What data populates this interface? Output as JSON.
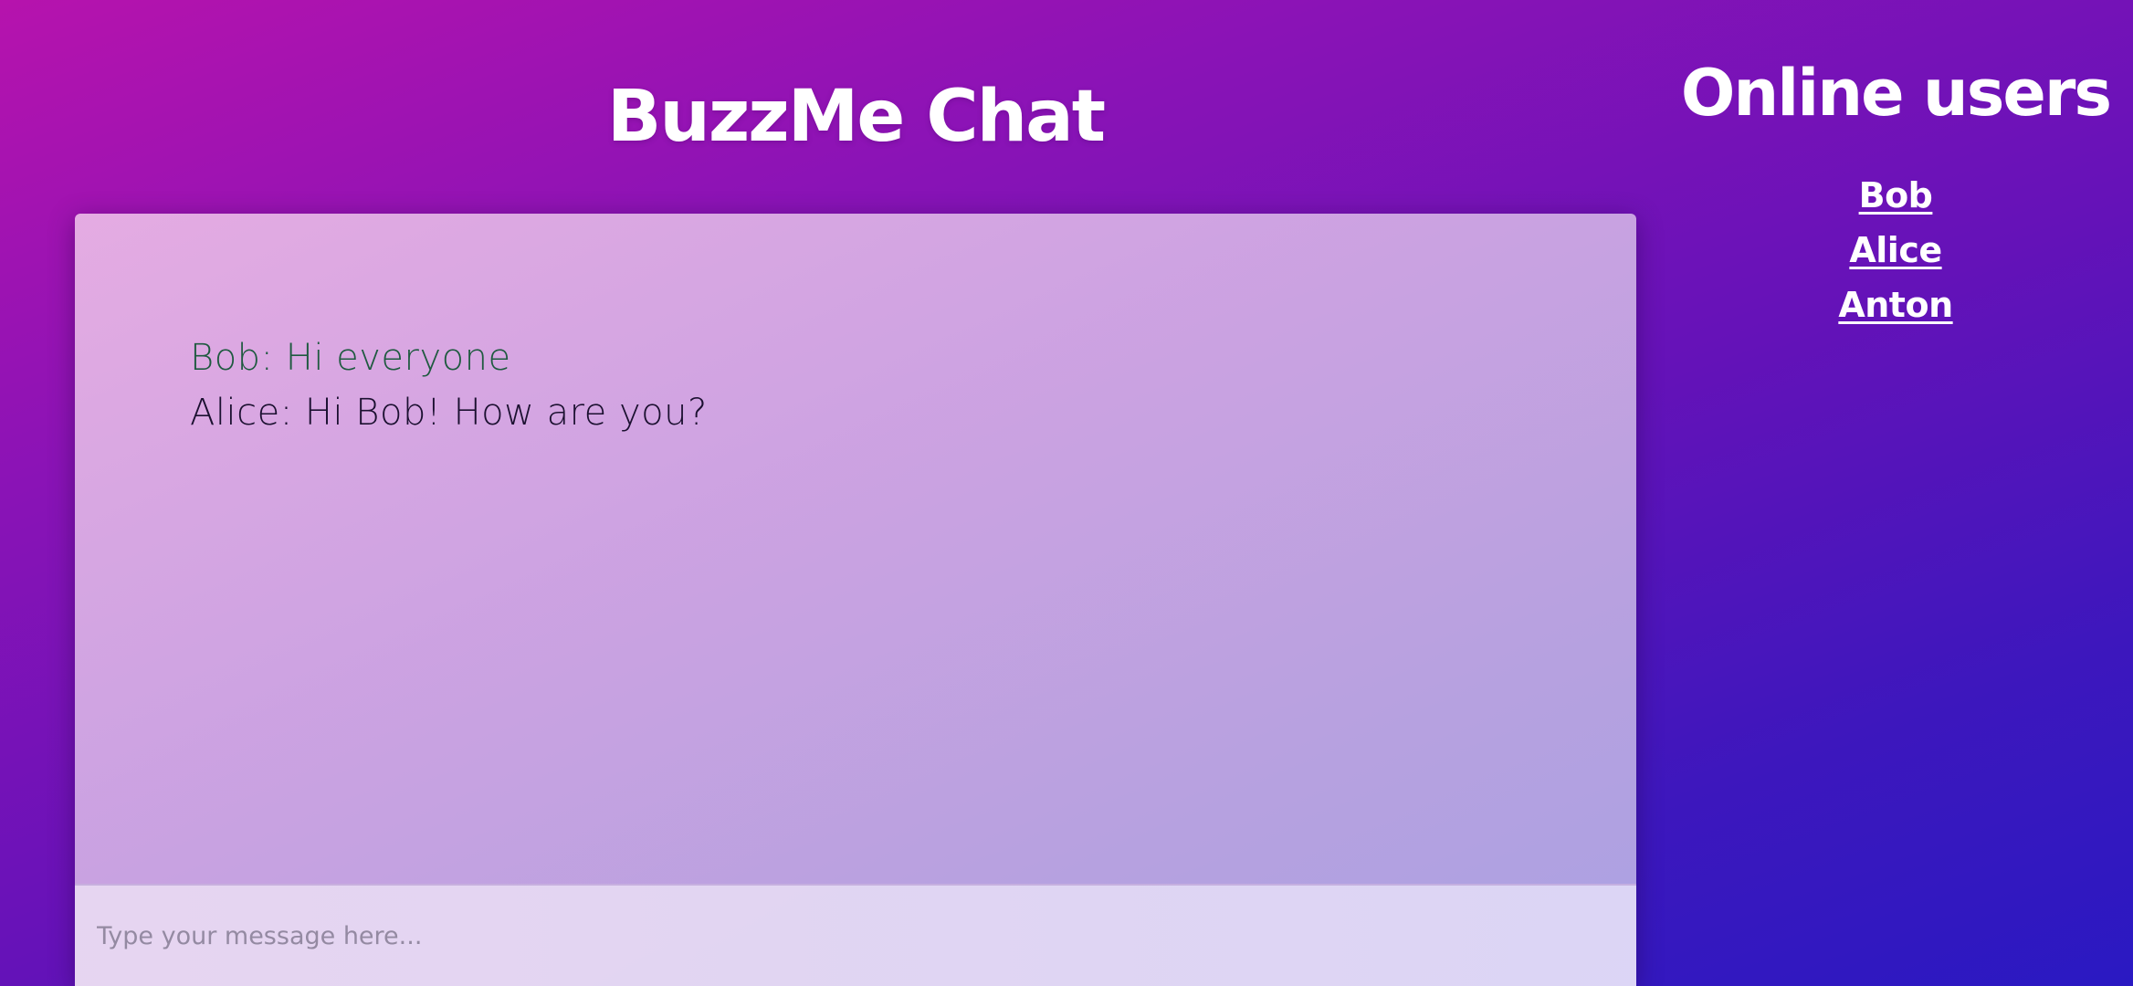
{
  "app": {
    "title": "BuzzMe Chat"
  },
  "chat": {
    "messages": [
      {
        "sender": "Bob",
        "text": "Bob: Hi everyone",
        "color": "#1f5a40"
      },
      {
        "sender": "Alice",
        "text": "Alice: Hi Bob! How are you?",
        "color": "#1b1030"
      }
    ],
    "input": {
      "value": "",
      "placeholder": "Type your message here..."
    }
  },
  "users": {
    "title": "Online users",
    "items": [
      {
        "label": "Bob"
      },
      {
        "label": "Alice"
      },
      {
        "label": "Anton"
      }
    ]
  },
  "colors": {
    "background_start": "#b613ad",
    "background_end": "#2a19c2",
    "text_light": "#ffffff"
  }
}
